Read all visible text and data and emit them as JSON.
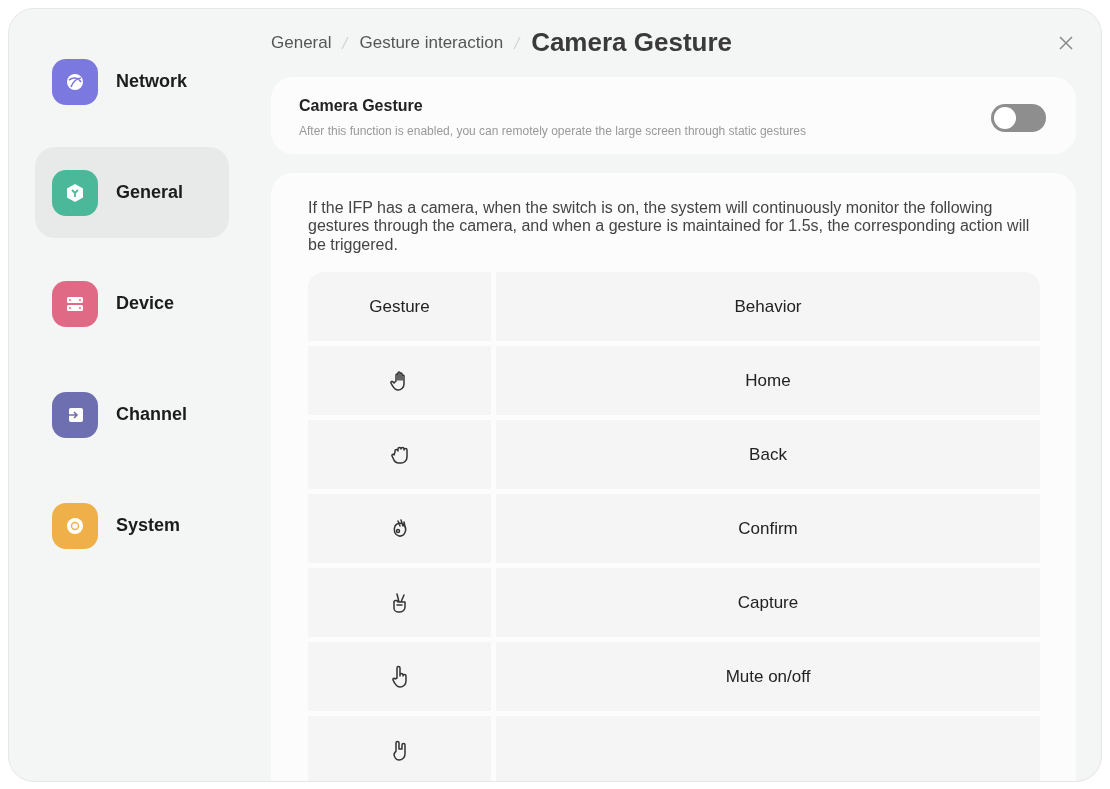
{
  "sidebar": {
    "items": [
      {
        "label": "Network",
        "kind": "network",
        "color": "#7b79e0",
        "selected": false
      },
      {
        "label": "General",
        "kind": "general",
        "color": "#4bb89a",
        "selected": true
      },
      {
        "label": "Device",
        "kind": "device",
        "color": "#e06a86",
        "selected": false
      },
      {
        "label": "Channel",
        "kind": "channel",
        "color": "#6e6fb0",
        "selected": false
      },
      {
        "label": "System",
        "kind": "system",
        "color": "#efb04a",
        "selected": false
      }
    ]
  },
  "breadcrumb": [
    "General",
    "Gesture interaction"
  ],
  "page_title": "Camera Gesture",
  "setting": {
    "title": "Camera Gesture",
    "description": "After this function is enabled, you can remotely operate the large screen through static gestures",
    "on": false
  },
  "intro": "If the IFP has a camera, when the switch is on, the system will continuously monitor the following gestures through the camera, and when a gesture is maintained for 1.5s, the corresponding action will be triggered.",
  "table": {
    "columns": [
      "Gesture",
      "Behavior"
    ],
    "rows": [
      {
        "kind": "open-palm",
        "behavior": "Home"
      },
      {
        "kind": "fist",
        "behavior": "Back"
      },
      {
        "kind": "ok",
        "behavior": "Confirm"
      },
      {
        "kind": "victory",
        "behavior": "Capture"
      },
      {
        "kind": "pointing",
        "behavior": "Mute on/off"
      },
      {
        "kind": "horns"
      }
    ]
  }
}
